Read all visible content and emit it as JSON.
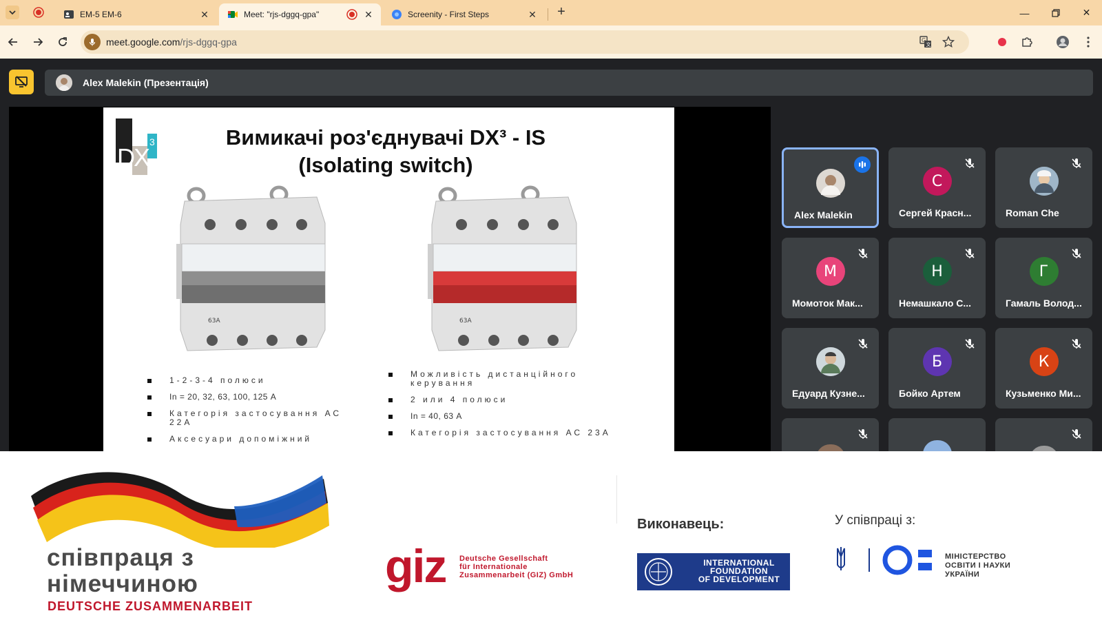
{
  "browser": {
    "tabs": [
      {
        "title": "EM-5 EM-6",
        "active": false
      },
      {
        "title": "Meet: \"rjs-dggq-gpa\"",
        "active": true
      },
      {
        "title": "Screenity - First Steps",
        "active": false
      }
    ],
    "url_host": "meet.google.com",
    "url_path": "/rjs-dggq-gpa"
  },
  "meet": {
    "presenter_label": "Alex Malekin (Презентація)",
    "participants": [
      {
        "name": "Alex Malekin",
        "initial": "",
        "color": "#6b6b6b",
        "speaking": true,
        "muted": false
      },
      {
        "name": "Сергей Красн...",
        "initial": "С",
        "color": "#c2185b",
        "speaking": false,
        "muted": true
      },
      {
        "name": "Roman Che",
        "initial": "",
        "color": "#8aa3b8",
        "speaking": false,
        "muted": true
      },
      {
        "name": "Момоток Мак...",
        "initial": "М",
        "color": "#e8447a",
        "speaking": false,
        "muted": true
      },
      {
        "name": "Немашкало С...",
        "initial": "Н",
        "color": "#1b5e3b",
        "speaking": false,
        "muted": true
      },
      {
        "name": "Гамаль Волод...",
        "initial": "Г",
        "color": "#2e7d32",
        "speaking": false,
        "muted": true
      },
      {
        "name": "Едуард Кузне...",
        "initial": "",
        "color": "#9aa6ad",
        "speaking": false,
        "muted": true
      },
      {
        "name": "Бойко Артем",
        "initial": "Б",
        "color": "#5e35b1",
        "speaking": false,
        "muted": true
      },
      {
        "name": "Кузьменко Ми...",
        "initial": "К",
        "color": "#d84315",
        "speaking": false,
        "muted": true
      }
    ]
  },
  "slide": {
    "logo_text": "DX",
    "logo_sup": "3",
    "title_line1": "Вимикачі роз'єднувачі DX³  - IS",
    "title_line2": "(Isolating switch)",
    "breaker_label": "63A",
    "left_bullets": [
      "1-2-3-4 полюси",
      "In = 20, 32, 63, 100, 125 А",
      "Категорія застосування АС 22А",
      "Аксесуари допоміжний"
    ],
    "right_bullets": [
      "Можливість дистанційного керування",
      "2 или 4 полюси",
      "In = 40, 63 А",
      "Категорія застосування АС 23А"
    ]
  },
  "banner": {
    "coop_line1": "співпраця з",
    "coop_line2": "німеччиною",
    "coop_sub": "DEUTSCHE ZUSAMMENARBEIT",
    "giz_word": "giz",
    "giz_line1": "Deutsche Gesellschaft",
    "giz_line2": "für Internationale",
    "giz_line3": "Zusammenarbeit (GIZ) GmbH",
    "executor_label": "Виконавець:",
    "ifd_line1": "INTERNATIONAL",
    "ifd_line2": "FOUNDATION",
    "ifd_line3": "OF DEVELOPMENT",
    "partner_label": "У співпраці з:",
    "mon_line1": "МІНІСТЕРСТВО",
    "mon_line2": "ОСВІТИ І НАУКИ",
    "mon_line3": "УКРАЇНИ"
  }
}
